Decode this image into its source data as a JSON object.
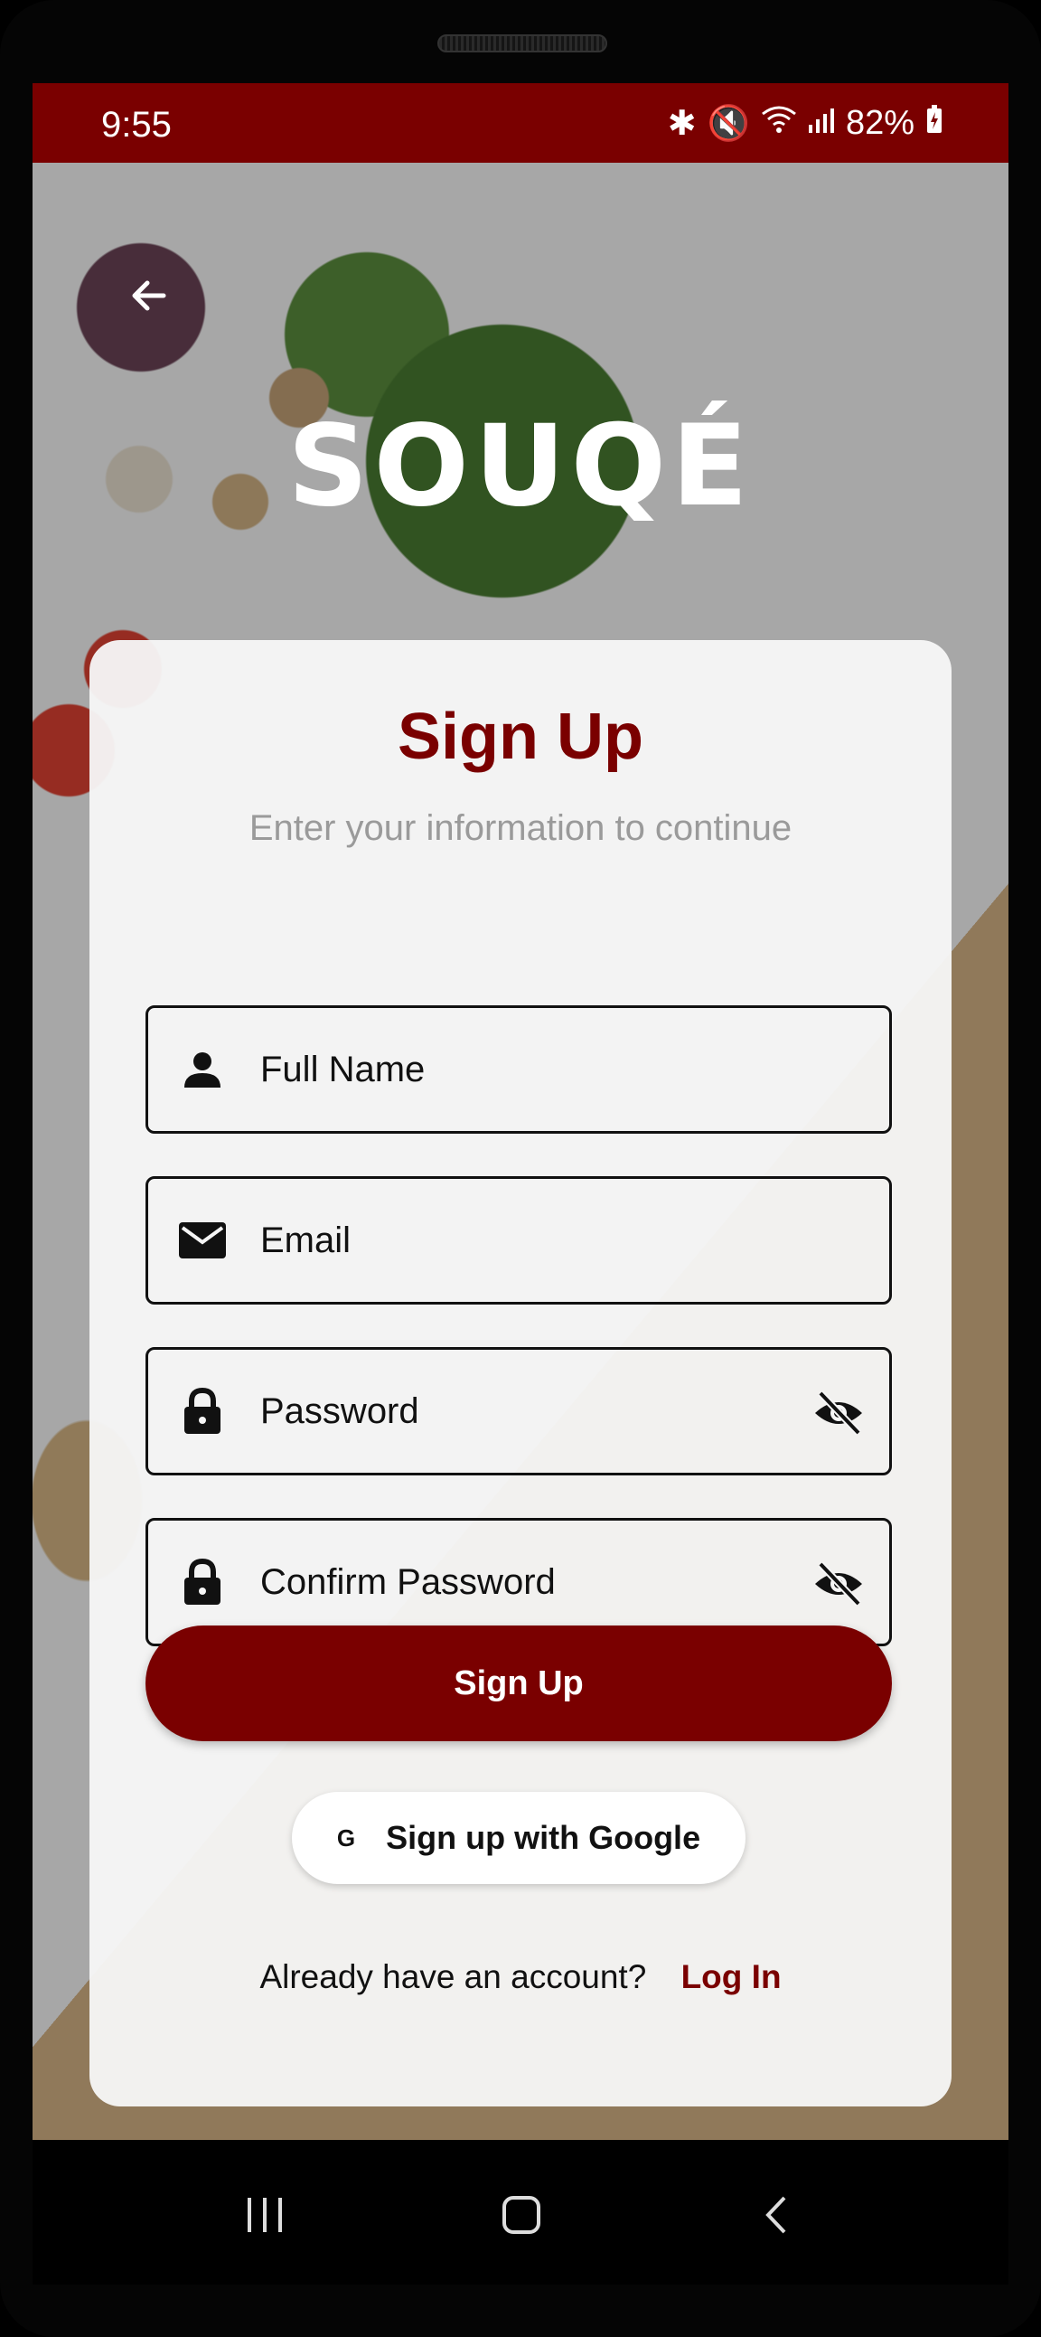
{
  "status_bar": {
    "time": "9:55",
    "battery": "82%"
  },
  "header": {
    "back_icon": "arrow-left-icon",
    "logo": "SOUQÉ"
  },
  "form": {
    "title": "Sign Up",
    "subtitle": "Enter your information to continue",
    "fields": [
      {
        "placeholder": "Full Name",
        "icon": "person-icon"
      },
      {
        "placeholder": "Email",
        "icon": "mail-icon"
      },
      {
        "placeholder": "Password",
        "icon": "lock-icon",
        "toggle_icon": "eye-off-icon"
      },
      {
        "placeholder": "Confirm Password",
        "icon": "lock-icon",
        "toggle_icon": "eye-off-icon"
      }
    ],
    "submit_label": "Sign Up",
    "google_icon": "G",
    "google_label": "Sign up with Google",
    "footer_text": "Already have an account?",
    "login_link": "Log In"
  },
  "colors": {
    "brand": "#7a0000",
    "card": "#f6f6f6"
  }
}
